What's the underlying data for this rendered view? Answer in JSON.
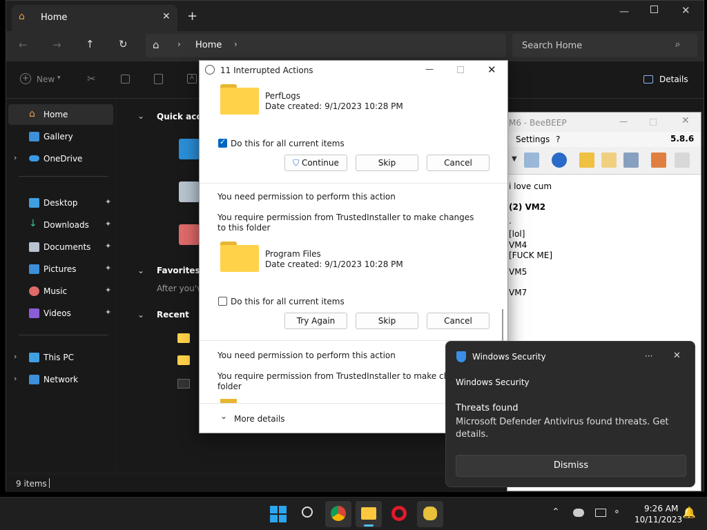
{
  "explorer": {
    "tab_title": "Home",
    "new_tab": "+",
    "breadcrumb_home": "Home",
    "search_placeholder": "Search Home",
    "toolbar_new": "New",
    "details_label": "Details",
    "sidebar": {
      "home": "Home",
      "gallery": "Gallery",
      "onedrive": "OneDrive",
      "desktop": "Desktop",
      "downloads": "Downloads",
      "documents": "Documents",
      "pictures": "Pictures",
      "music": "Music",
      "videos": "Videos",
      "this_pc": "This PC",
      "network": "Network"
    },
    "sections": {
      "quick_access": "Quick acces",
      "favorites": "Favorites",
      "favorites_hint": "After you've",
      "recent": "Recent"
    },
    "status_items": "9 items"
  },
  "dialog": {
    "title": "11 Interrupted Actions",
    "item1": {
      "name": "PerfLogs",
      "date": "Date created: 9/1/2023 10:28 PM"
    },
    "checkbox1": {
      "label": "Do this for all current items",
      "checked": true
    },
    "continue_label": "Continue",
    "skip_label": "Skip",
    "cancel_label": "Cancel",
    "section2": {
      "heading": "You need permission to perform this action",
      "desc": "You require permission from TrustedInstaller to make changes to this folder",
      "name": "Program Files",
      "date": "Date created: 9/1/2023 10:28 PM"
    },
    "checkbox2": {
      "label": "Do this for all current items",
      "checked": false
    },
    "tryagain_label": "Try Again",
    "section3": {
      "heading": "You need permission to perform this action",
      "desc1": "You require permission from TrustedInstaller to make changes t",
      "desc2": "folder"
    },
    "more_details": "More details"
  },
  "beebeep": {
    "title": "M6 - BeeBEEP",
    "menu_settings": "Settings",
    "menu_help": "?",
    "version": "5.8.6",
    "lines": [
      "i love cum",
      "(2) VM2",
      ".",
      "[lol]",
      "VM4",
      "[FUCK ME]",
      "VM5",
      "VM7"
    ]
  },
  "toast": {
    "app": "Windows Security",
    "source": "Windows Security",
    "title": "Threats found",
    "body": "Microsoft Defender Antivirus found threats. Get details.",
    "dismiss": "Dismiss",
    "more": "···"
  },
  "taskbar": {
    "time": "9:26 AM",
    "date": "10/11/2023"
  },
  "colors": {
    "accent": "#0067c0",
    "folder": "#ffd24a",
    "dark_bg": "#191919"
  }
}
